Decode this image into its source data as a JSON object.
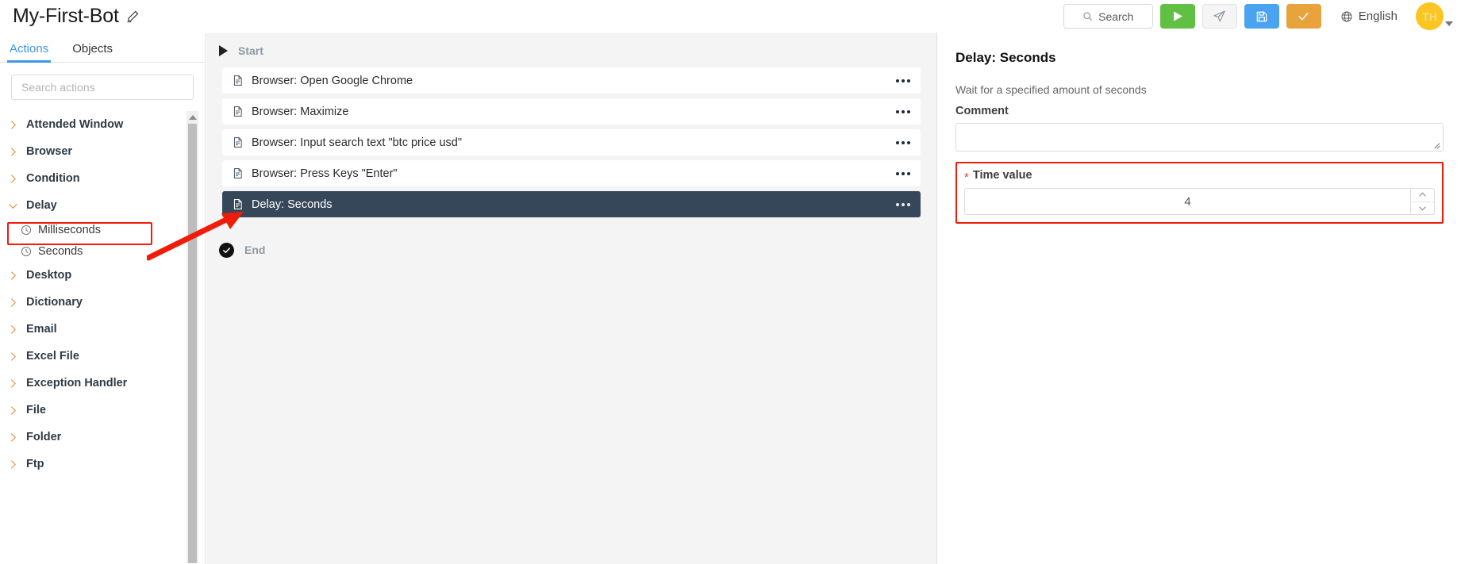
{
  "topbar": {
    "bot_name": "My-First-Bot",
    "edit_icon": "pencil-icon",
    "search_label": "Search",
    "search_icon": "search-icon",
    "run_icon": "play-icon",
    "send_icon": "paper-plane-icon",
    "save_icon": "floppy-disk-icon",
    "check_icon": "checkmark-icon",
    "language_icon": "globe-icon",
    "language": "English",
    "avatar_initials": "TH",
    "colors": {
      "run": "#61bf44",
      "save": "#4aa3f0",
      "check": "#e8a33d",
      "avatar": "#fcc521",
      "accent": "#3b97e8",
      "annotation": "#f01c0a",
      "selected_row": "#37475a"
    }
  },
  "sidebar": {
    "tabs": [
      {
        "label": "Actions",
        "active": true
      },
      {
        "label": "Objects",
        "active": false
      }
    ],
    "search_placeholder": "Search actions",
    "tree": [
      {
        "label": "Attended Window",
        "expanded": false
      },
      {
        "label": "Browser",
        "expanded": false
      },
      {
        "label": "Condition",
        "expanded": false
      },
      {
        "label": "Delay",
        "expanded": true,
        "children": [
          {
            "label": "Milliseconds",
            "icon": "clock-icon",
            "highlighted": false
          },
          {
            "label": "Seconds",
            "icon": "clock-icon",
            "highlighted": true
          }
        ]
      },
      {
        "label": "Desktop",
        "expanded": false
      },
      {
        "label": "Dictionary",
        "expanded": false
      },
      {
        "label": "Email",
        "expanded": false
      },
      {
        "label": "Excel File",
        "expanded": false
      },
      {
        "label": "Exception Handler",
        "expanded": false
      },
      {
        "label": "File",
        "expanded": false
      },
      {
        "label": "Folder",
        "expanded": false
      },
      {
        "label": "Ftp",
        "expanded": false
      }
    ]
  },
  "flow": {
    "start_label": "Start",
    "end_label": "End",
    "steps": [
      {
        "label": "Browser: Open Google Chrome",
        "selected": false
      },
      {
        "label": "Browser: Maximize",
        "selected": false
      },
      {
        "label": "Browser: Input search text \"btc price usd\"",
        "selected": false
      },
      {
        "label": "Browser: Press Keys \"Enter\"",
        "selected": false
      },
      {
        "label": "Delay: Seconds",
        "selected": true
      }
    ]
  },
  "properties": {
    "title": "Delay: Seconds",
    "description": "Wait for a specified amount of seconds",
    "comment_label": "Comment",
    "comment_value": "",
    "time_value_label": "Time value",
    "time_value_required": "*",
    "time_value": "4",
    "time_value_highlighted": true
  }
}
